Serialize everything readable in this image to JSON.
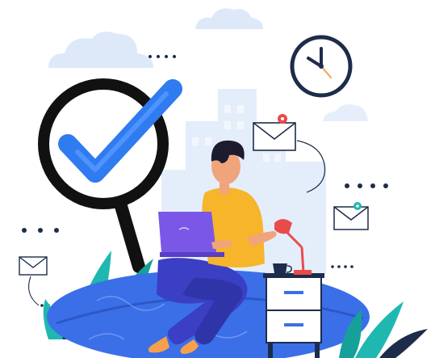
{
  "colors": {
    "background": "#ffffff",
    "cloud": "#dde9f8",
    "skyline": "#e4eefb",
    "magnifier_ring": "#111111",
    "check": "#2f7bf0",
    "check_dark": "#1f5fd6",
    "pouf": "#3b6fe8",
    "pouf_dark": "#2d57c6",
    "shirt": "#f6b52a",
    "pants": "#3a3fc4",
    "laptop": "#7b57e8",
    "skin": "#f0a47c",
    "hair": "#1c1c2e",
    "shoe": "#f6a04b",
    "lamp": "#e94b4b",
    "plant_teal": "#1fb8b0",
    "plant_dark": "#1d2c4a",
    "nightstand": "#ffffff",
    "nightstand_outline": "#1d2c4a",
    "nightstand_accent": "#3b6fe8",
    "mail_badge_red": "#e94b4b",
    "mail_badge_teal": "#1fb8b0",
    "dots": "#1d2c4a"
  },
  "icons": [
    "cloud-icon",
    "clock-icon",
    "magnifier-icon",
    "checkmark-icon",
    "envelope-icon",
    "notification-badge-icon",
    "desk-lamp-icon",
    "coffee-cup-icon",
    "plant-icon",
    "laptop-icon"
  ]
}
